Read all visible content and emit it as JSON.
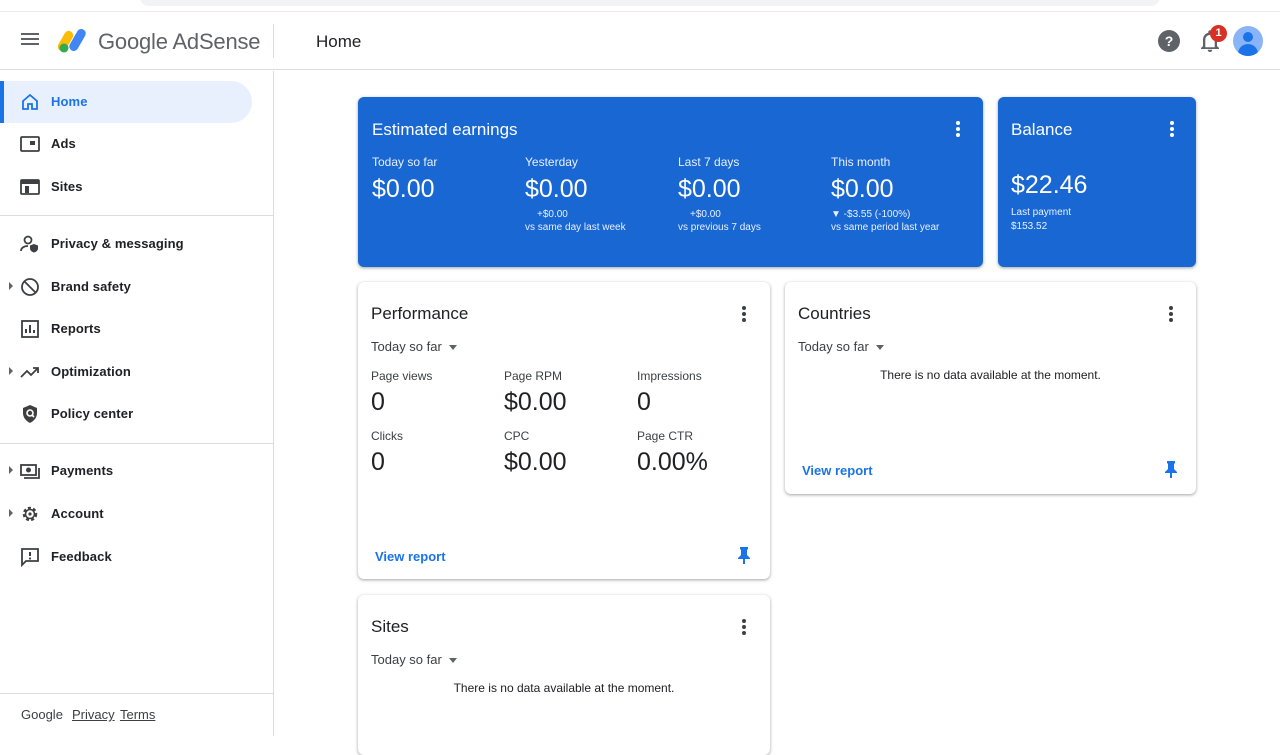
{
  "header": {
    "app_name": "Google AdSense",
    "page_title": "Home",
    "notification_count": "1",
    "help_glyph": "?"
  },
  "sidebar": {
    "items": [
      {
        "label": "Home",
        "icon": "home-icon"
      },
      {
        "label": "Ads",
        "icon": "ads-icon"
      },
      {
        "label": "Sites",
        "icon": "sites-icon"
      },
      {
        "label": "Privacy & messaging",
        "icon": "privacy-icon"
      },
      {
        "label": "Brand safety",
        "icon": "block-icon"
      },
      {
        "label": "Reports",
        "icon": "reports-icon"
      },
      {
        "label": "Optimization",
        "icon": "trending-icon"
      },
      {
        "label": "Policy center",
        "icon": "policy-icon"
      },
      {
        "label": "Payments",
        "icon": "payments-icon"
      },
      {
        "label": "Account",
        "icon": "gear-icon"
      },
      {
        "label": "Feedback",
        "icon": "feedback-icon"
      }
    ],
    "footer": {
      "google": "Google",
      "privacy": "Privacy",
      "terms": "Terms"
    }
  },
  "earnings": {
    "title": "Estimated earnings",
    "columns": [
      {
        "label": "Today so far",
        "value": "$0.00",
        "delta": "",
        "compare": ""
      },
      {
        "label": "Yesterday",
        "value": "$0.00",
        "delta": "+$0.00",
        "compare": "vs same day last week"
      },
      {
        "label": "Last 7 days",
        "value": "$0.00",
        "delta": "+$0.00",
        "compare": "vs previous 7 days"
      },
      {
        "label": "This month",
        "value": "$0.00",
        "delta": "▼ -$3.55 (-100%)",
        "compare": "vs same period last year"
      }
    ]
  },
  "balance": {
    "title": "Balance",
    "value": "$22.46",
    "last_payment_label": "Last payment",
    "last_payment_value": "$153.52"
  },
  "performance": {
    "title": "Performance",
    "range": "Today so far",
    "metrics": [
      {
        "label": "Page views",
        "value": "0"
      },
      {
        "label": "Page RPM",
        "value": "$0.00"
      },
      {
        "label": "Impressions",
        "value": "0"
      },
      {
        "label": "Clicks",
        "value": "0"
      },
      {
        "label": "CPC",
        "value": "$0.00"
      },
      {
        "label": "Page CTR",
        "value": "0.00%"
      }
    ],
    "view_report": "View report"
  },
  "countries": {
    "title": "Countries",
    "range": "Today so far",
    "empty": "There is no data available at the moment.",
    "view_report": "View report"
  },
  "sites": {
    "title": "Sites",
    "range": "Today so far",
    "empty": "There is no data available at the moment."
  },
  "colors": {
    "accent": "#1a73e8",
    "card_blue": "#1967d2",
    "badge": "#d93025"
  }
}
